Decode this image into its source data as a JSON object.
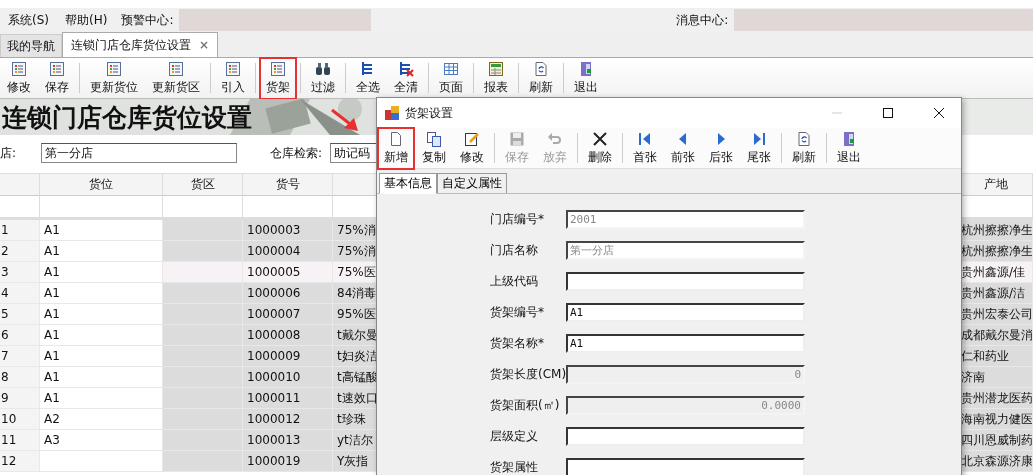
{
  "menu": {
    "items": [
      "系统(S)",
      "帮助(H)"
    ],
    "alert_label": "预警中心:",
    "message_label": "消息中心:"
  },
  "tabs": [
    {
      "label": "我的导航",
      "selected": false
    },
    {
      "label": "连锁门店仓库货位设置",
      "selected": true,
      "close": "×"
    }
  ],
  "toolbar": [
    {
      "label": "修改",
      "kind": "list",
      "highlighted": false,
      "sep": false
    },
    {
      "label": "保存",
      "kind": "list",
      "highlighted": false,
      "sep": true
    },
    {
      "label": "更新货位",
      "kind": "list",
      "highlighted": false,
      "sep": false
    },
    {
      "label": "更新货区",
      "kind": "list",
      "highlighted": false,
      "sep": true
    },
    {
      "label": "引入",
      "kind": "list",
      "highlighted": false,
      "sep": true
    },
    {
      "label": "货架",
      "kind": "list",
      "highlighted": true,
      "sep": true
    },
    {
      "label": "过滤",
      "kind": "filter",
      "highlighted": false,
      "sep": true
    },
    {
      "label": "全选",
      "kind": "tree",
      "highlighted": false,
      "sep": false
    },
    {
      "label": "全清",
      "kind": "tree-clear",
      "highlighted": false,
      "sep": true
    },
    {
      "label": "页面",
      "kind": "grid",
      "highlighted": false,
      "sep": true
    },
    {
      "label": "报表",
      "kind": "report",
      "highlighted": false,
      "sep": true
    },
    {
      "label": "刷新",
      "kind": "refresh",
      "highlighted": false,
      "sep": true
    },
    {
      "label": "退出",
      "kind": "exit",
      "highlighted": false,
      "sep": false
    }
  ],
  "banner": {
    "title": "连锁门店仓库货位设置",
    "kind": "picture"
  },
  "filters": {
    "store_label": "店:",
    "store_value": "第一分店",
    "search_label": "仓库检索:",
    "search_value": "助记码"
  },
  "table": {
    "columns": [
      "货位",
      "货区",
      "货号",
      "产地"
    ],
    "rows": [
      {
        "no": "1",
        "location": "A1",
        "code": "1000003",
        "name": "75%消",
        "origin": "杭州擦擦净生",
        "selected": false
      },
      {
        "no": "2",
        "location": "A1",
        "code": "1000004",
        "name": "75%消",
        "origin": "杭州擦擦净生",
        "selected": false
      },
      {
        "no": "3",
        "location": "A1",
        "code": "1000005",
        "name": "75%医",
        "origin": "贵州鑫源/佳",
        "selected": true
      },
      {
        "no": "4",
        "location": "A1",
        "code": "1000006",
        "name": "84消毒",
        "origin": "贵州鑫源/洁",
        "selected": false
      },
      {
        "no": "5",
        "location": "A1",
        "code": "1000007",
        "name": "95%医",
        "origin": "贵州宏泰公司",
        "selected": false
      },
      {
        "no": "6",
        "location": "A1",
        "code": "1000008",
        "name": "t戴尔曼",
        "origin": "成都戴尔曼消",
        "selected": false
      },
      {
        "no": "7",
        "location": "A1",
        "code": "1000009",
        "name": "t妇炎洁",
        "origin": "仁和药业",
        "selected": false
      },
      {
        "no": "8",
        "location": "A1",
        "code": "1000010",
        "name": "t高锰酸",
        "origin": "济南",
        "selected": false
      },
      {
        "no": "9",
        "location": "A1",
        "code": "1000011",
        "name": "t速效口",
        "origin": "贵州潜龙医药",
        "selected": false
      },
      {
        "no": "10",
        "location": "A2",
        "code": "1000012",
        "name": "t珍珠",
        "origin": "海南视力健医",
        "selected": false
      },
      {
        "no": "11",
        "location": "A3",
        "code": "1000013",
        "name": "yt洁尔",
        "origin": "四川恩威制药",
        "selected": false
      },
      {
        "no": "12",
        "code": "1000019",
        "name": "Y灰指",
        "origin": "北京森源济康",
        "selected": false
      }
    ]
  },
  "dialog": {
    "title": "货架设置",
    "toolbar": [
      {
        "label": "新增",
        "kind": "new",
        "disabled": false,
        "highlighted": true,
        "sep": false
      },
      {
        "label": "复制",
        "kind": "copy",
        "disabled": false,
        "highlighted": false,
        "sep": false
      },
      {
        "label": "修改",
        "kind": "edit",
        "disabled": false,
        "highlighted": false,
        "sep": true
      },
      {
        "label": "保存",
        "kind": "save",
        "disabled": true,
        "highlighted": false,
        "sep": false
      },
      {
        "label": "放弃",
        "kind": "undo",
        "disabled": true,
        "highlighted": false,
        "sep": true
      },
      {
        "label": "删除",
        "kind": "delete",
        "disabled": false,
        "highlighted": false,
        "sep": true
      },
      {
        "label": "首张",
        "kind": "first",
        "disabled": false,
        "highlighted": false,
        "sep": false
      },
      {
        "label": "前张",
        "kind": "prev",
        "disabled": false,
        "highlighted": false,
        "sep": false
      },
      {
        "label": "后张",
        "kind": "next",
        "disabled": false,
        "highlighted": false,
        "sep": false
      },
      {
        "label": "尾张",
        "kind": "last",
        "disabled": false,
        "highlighted": false,
        "sep": true
      },
      {
        "label": "刷新",
        "kind": "refresh",
        "disabled": false,
        "highlighted": false,
        "sep": true
      },
      {
        "label": "退出",
        "kind": "exit",
        "disabled": false,
        "highlighted": false,
        "sep": false
      }
    ],
    "tabs": [
      {
        "label": "基本信息",
        "selected": true
      },
      {
        "label": "自定义属性",
        "selected": false
      }
    ],
    "fields": [
      {
        "label": "门店编号*",
        "value": "2001",
        "kind": "text",
        "disabled": true
      },
      {
        "label": "门店名称",
        "value": "第一分店",
        "kind": "text",
        "disabled": true
      },
      {
        "label": "上级代码",
        "kind": "text",
        "disabled": false
      },
      {
        "label": "货架编号*",
        "value": "A1",
        "kind": "text",
        "disabled": false
      },
      {
        "label": "货架名称*",
        "value": "A1",
        "kind": "text",
        "disabled": false
      },
      {
        "label": "货架长度(CM)",
        "value": "0",
        "kind": "number",
        "disabled": true
      },
      {
        "label": "货架面积(㎡)",
        "value": "0.0000",
        "kind": "number",
        "disabled": true
      },
      {
        "label": "层级定义",
        "kind": "text",
        "disabled": false
      },
      {
        "label": "货架属性",
        "kind": "text",
        "disabled": false
      }
    ]
  }
}
